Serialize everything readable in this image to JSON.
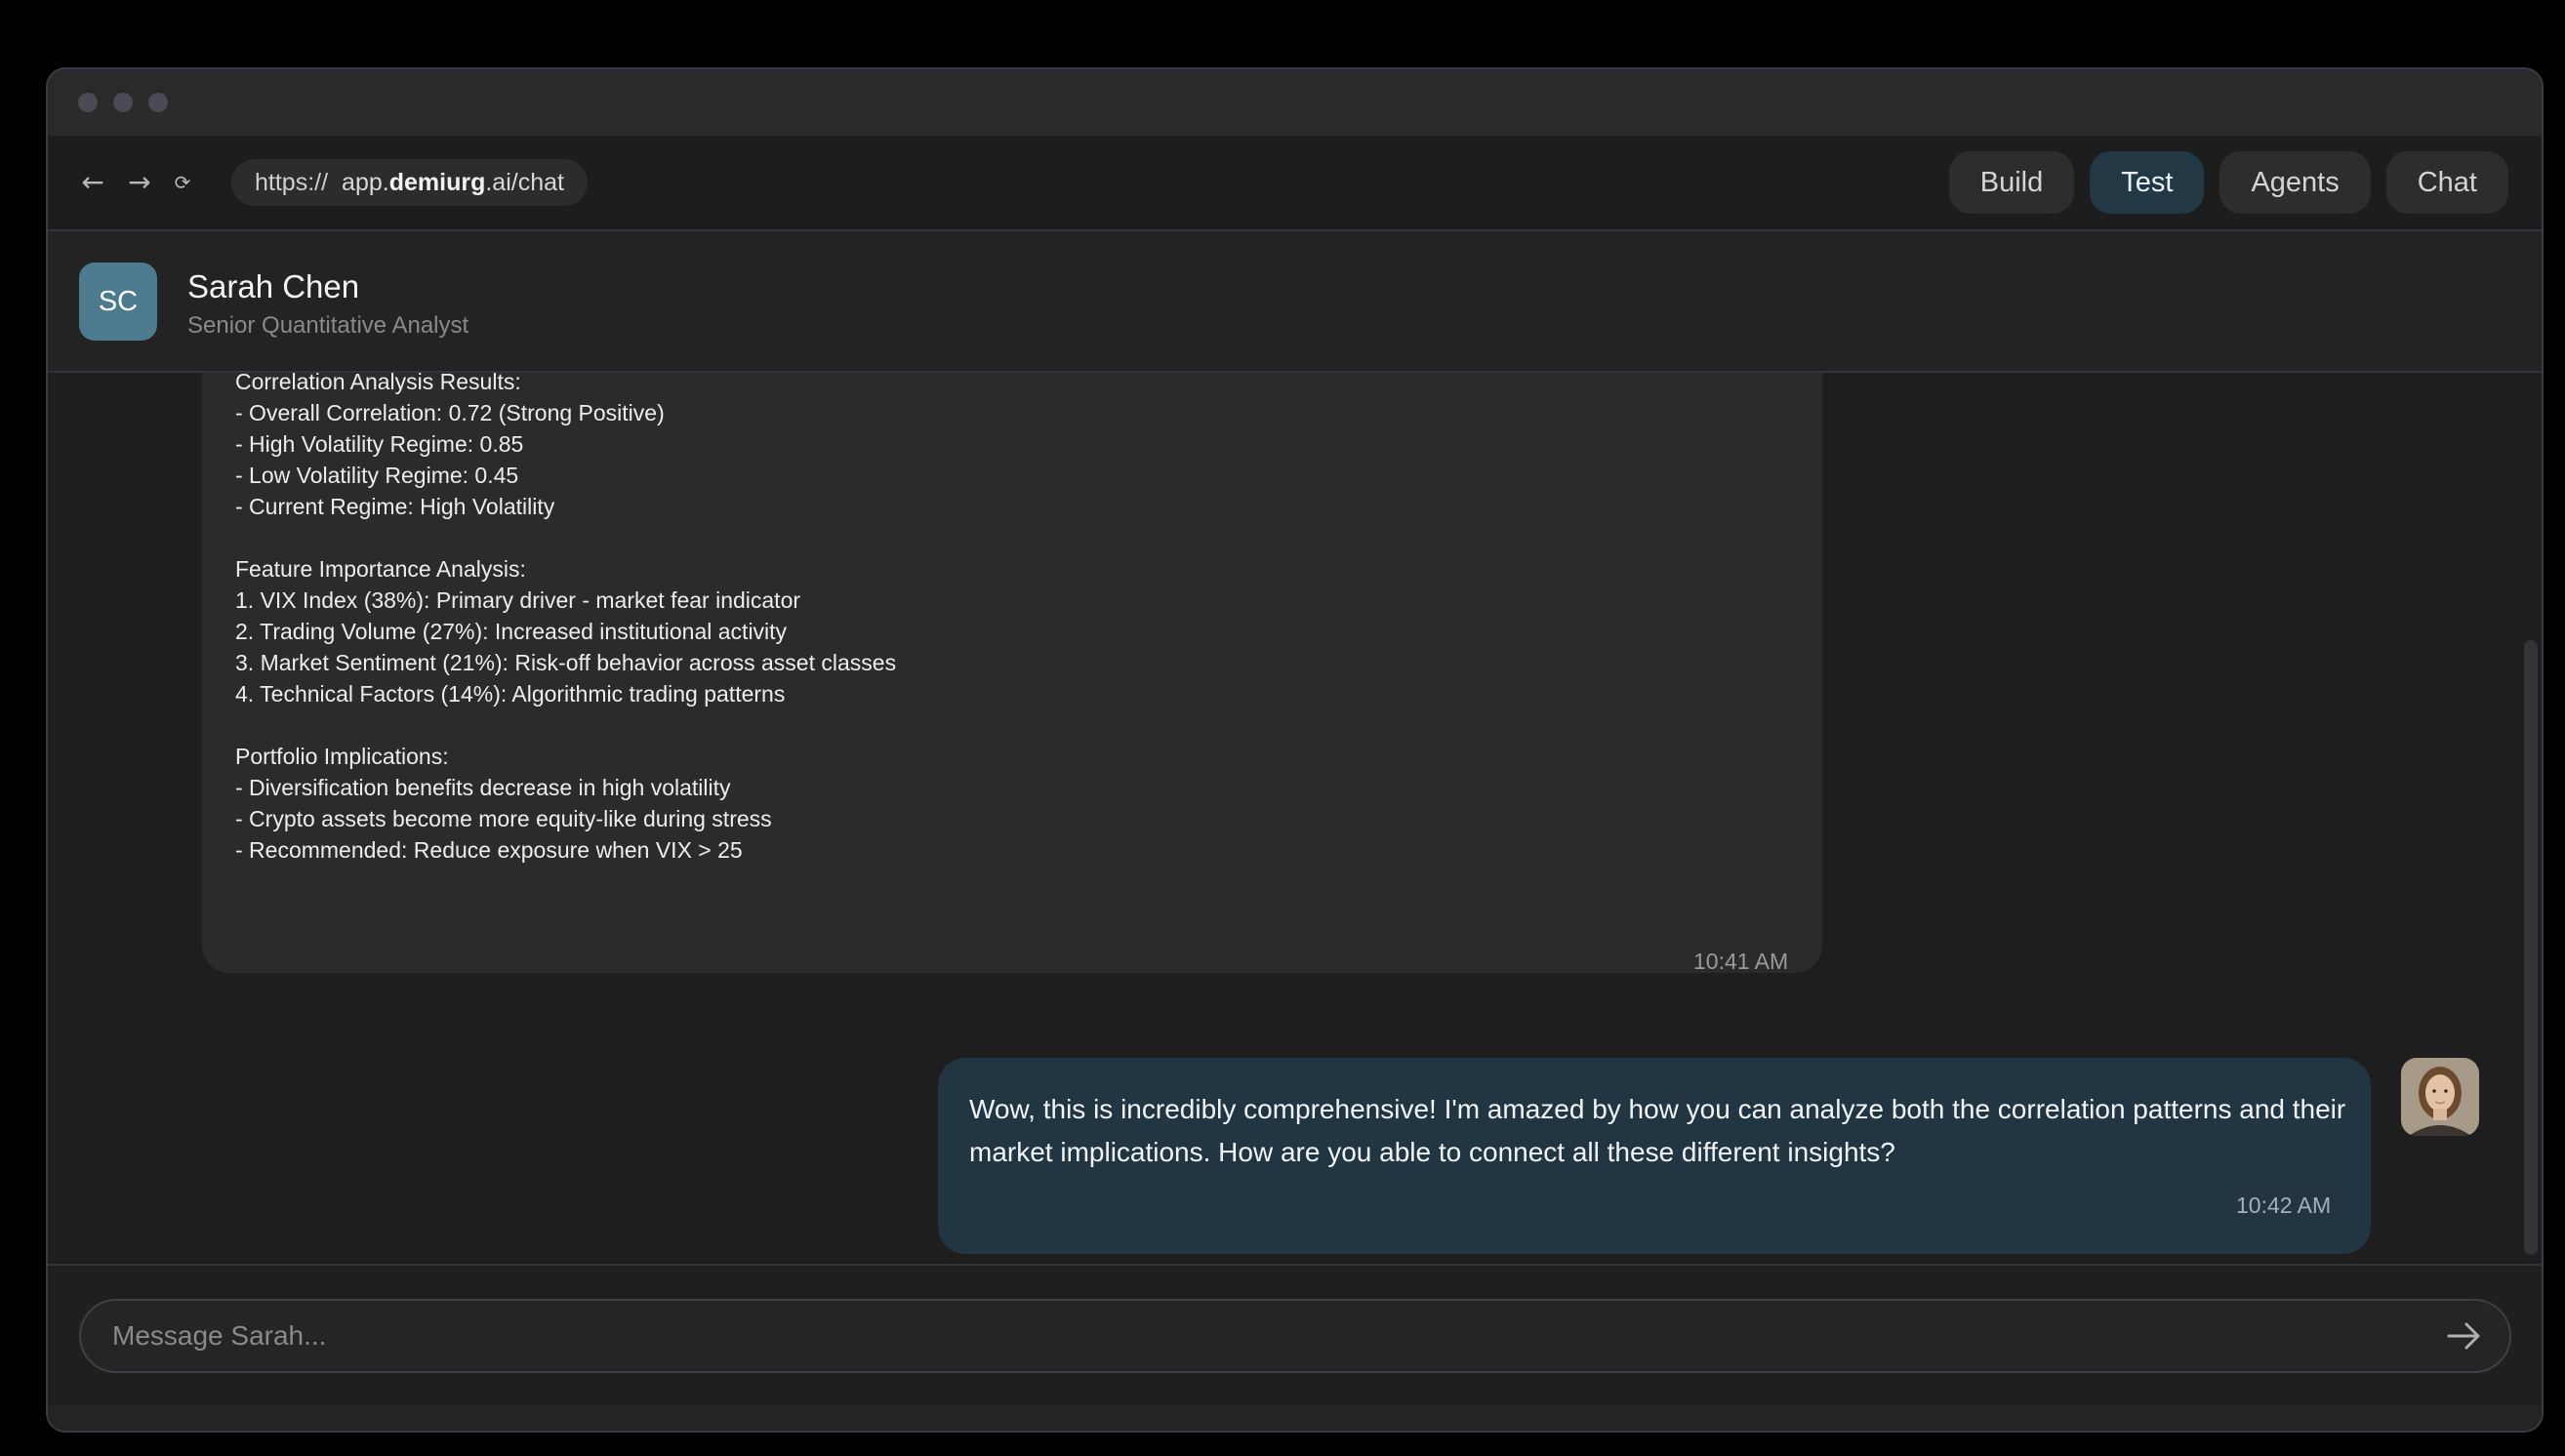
{
  "browser": {
    "url_protocol": "https://",
    "url_host_prefix": "app.",
    "url_host_bold": "demiurg",
    "url_rest": ".ai/chat",
    "tabs": [
      {
        "label": "Build",
        "active": false
      },
      {
        "label": "Test",
        "active": true
      },
      {
        "label": "Agents",
        "active": false
      },
      {
        "label": "Chat",
        "active": false
      }
    ]
  },
  "contact": {
    "initials": "SC",
    "name": "Sarah Chen",
    "role": "Senior Quantitative Analyst",
    "avatar_color": "#4c7a8e"
  },
  "messages": [
    {
      "sender": "agent",
      "lines": [
        "Correlation Analysis Results:",
        "- Overall Correlation: 0.72 (Strong Positive)",
        "- High Volatility Regime: 0.85",
        "- Low Volatility Regime: 0.45",
        "- Current Regime: High Volatility",
        "",
        "Feature Importance Analysis:",
        "1. VIX Index (38%): Primary driver - market fear indicator",
        "2. Trading Volume (27%): Increased institutional activity",
        "3. Market Sentiment (21%): Risk-off behavior across asset classes",
        "4. Technical Factors (14%): Algorithmic trading patterns",
        "",
        "Portfolio Implications:",
        "- Diversification benefits decrease in high volatility",
        "- Crypto assets become more equity-like during stress",
        "- Recommended: Reduce exposure when VIX > 25"
      ],
      "time": "10:41 AM"
    },
    {
      "sender": "user",
      "text": "Wow, this is incredibly comprehensive! I'm amazed by how you can analyze both the correlation patterns and their market implications. How are you able to connect all these different insights?",
      "time": "10:42 AM"
    }
  ],
  "composer": {
    "placeholder": "Message Sarah...",
    "value": ""
  },
  "colors": {
    "user_bubble": "#223542",
    "agent_bubble": "#2b2b2b",
    "active_tab": "#223845"
  },
  "icons": [
    "back-arrow-icon",
    "forward-arrow-icon",
    "reload-icon",
    "send-arrow-icon"
  ]
}
